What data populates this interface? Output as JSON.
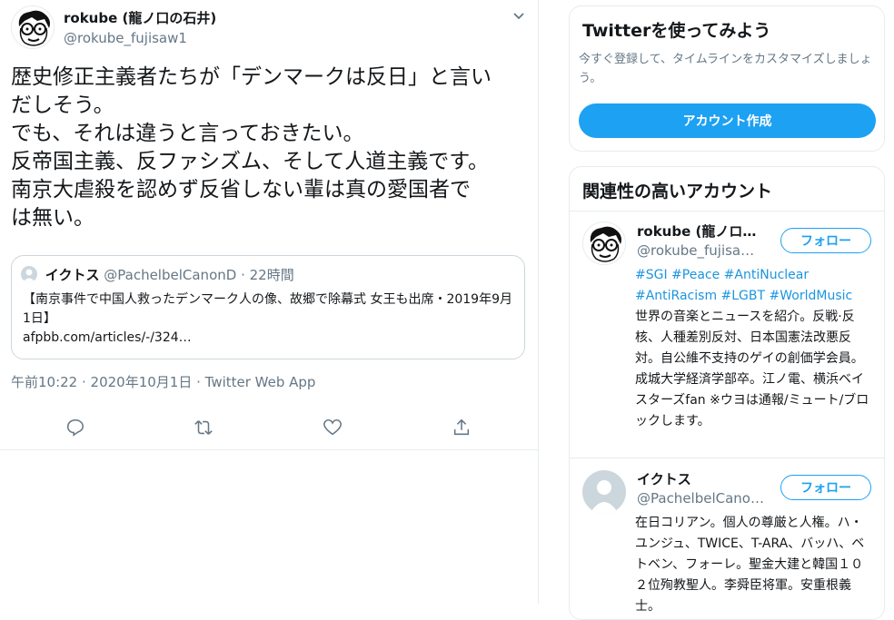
{
  "tweet": {
    "author_name": "rokube (龍ノ口の石井)",
    "author_handle": "@rokube_fujisaw1",
    "text": "歴史修正主義者たちが「デンマークは反日」と言い\nだしそう。\nでも、それは違うと言っておきたい。\n反帝国主義、反ファシズム、そして人道主義です。\n南京大虐殺を認めず反省しない輩は真の愛国者で\nは無い。",
    "timestamp": "午前10:22 · 2020年10月1日 · Twitter Web App"
  },
  "quote": {
    "author_name": "イクトス",
    "author_handle": "@PachelbelCanonD",
    "age": "· 22時間",
    "text": "【南京事件で中国人救ったデンマーク人の像、故郷で除幕式 女王も出席・2019年9月1日】",
    "link": "afpbb.com/articles/-/324…"
  },
  "actions": [
    "reply-icon",
    "retweet-icon",
    "like-icon",
    "share-icon"
  ],
  "signup": {
    "title": "Twitterを使ってみよう",
    "subtitle": "今すぐ登録して、タイムラインをカスタマイズしましょう。",
    "button": "アカウント作成"
  },
  "related": {
    "title": "関連性の高いアカウント",
    "accounts": [
      {
        "name": "rokube (龍ノロ…",
        "handle": "@rokube_fujisa…",
        "follow": "フォロー",
        "hashtags1": "#SGI #Peace #AntiNuclear",
        "hashtags2": "#AntiRacism #LGBT #WorldMusic",
        "bio": "世界の音楽とニュースを紹介。反戦·反核、人種差別反対、日本国憲法改悪反対。自公維不支持のゲイの創価学会員。成城大学経済学部卒。江ノ電、横浜ベイスターズfan ※ウヨは通報/ミュート/ブロックします。"
      },
      {
        "name": "イクトス",
        "handle": "@PachelbelCano…",
        "follow": "フォロー",
        "bio": "在日コリアン。個人の尊厳と人権。ハ・ユンジュ、TWICE、T-ARA、バッハ、ベトベン、フォーレ。聖金大建と韓国１０２位殉教聖人。李舜臣将軍。安重根義士。"
      }
    ]
  },
  "colors": {
    "accent": "#1da1f2",
    "link": "#1b95e0",
    "muted": "#657786",
    "border": "#e6ecf0"
  }
}
